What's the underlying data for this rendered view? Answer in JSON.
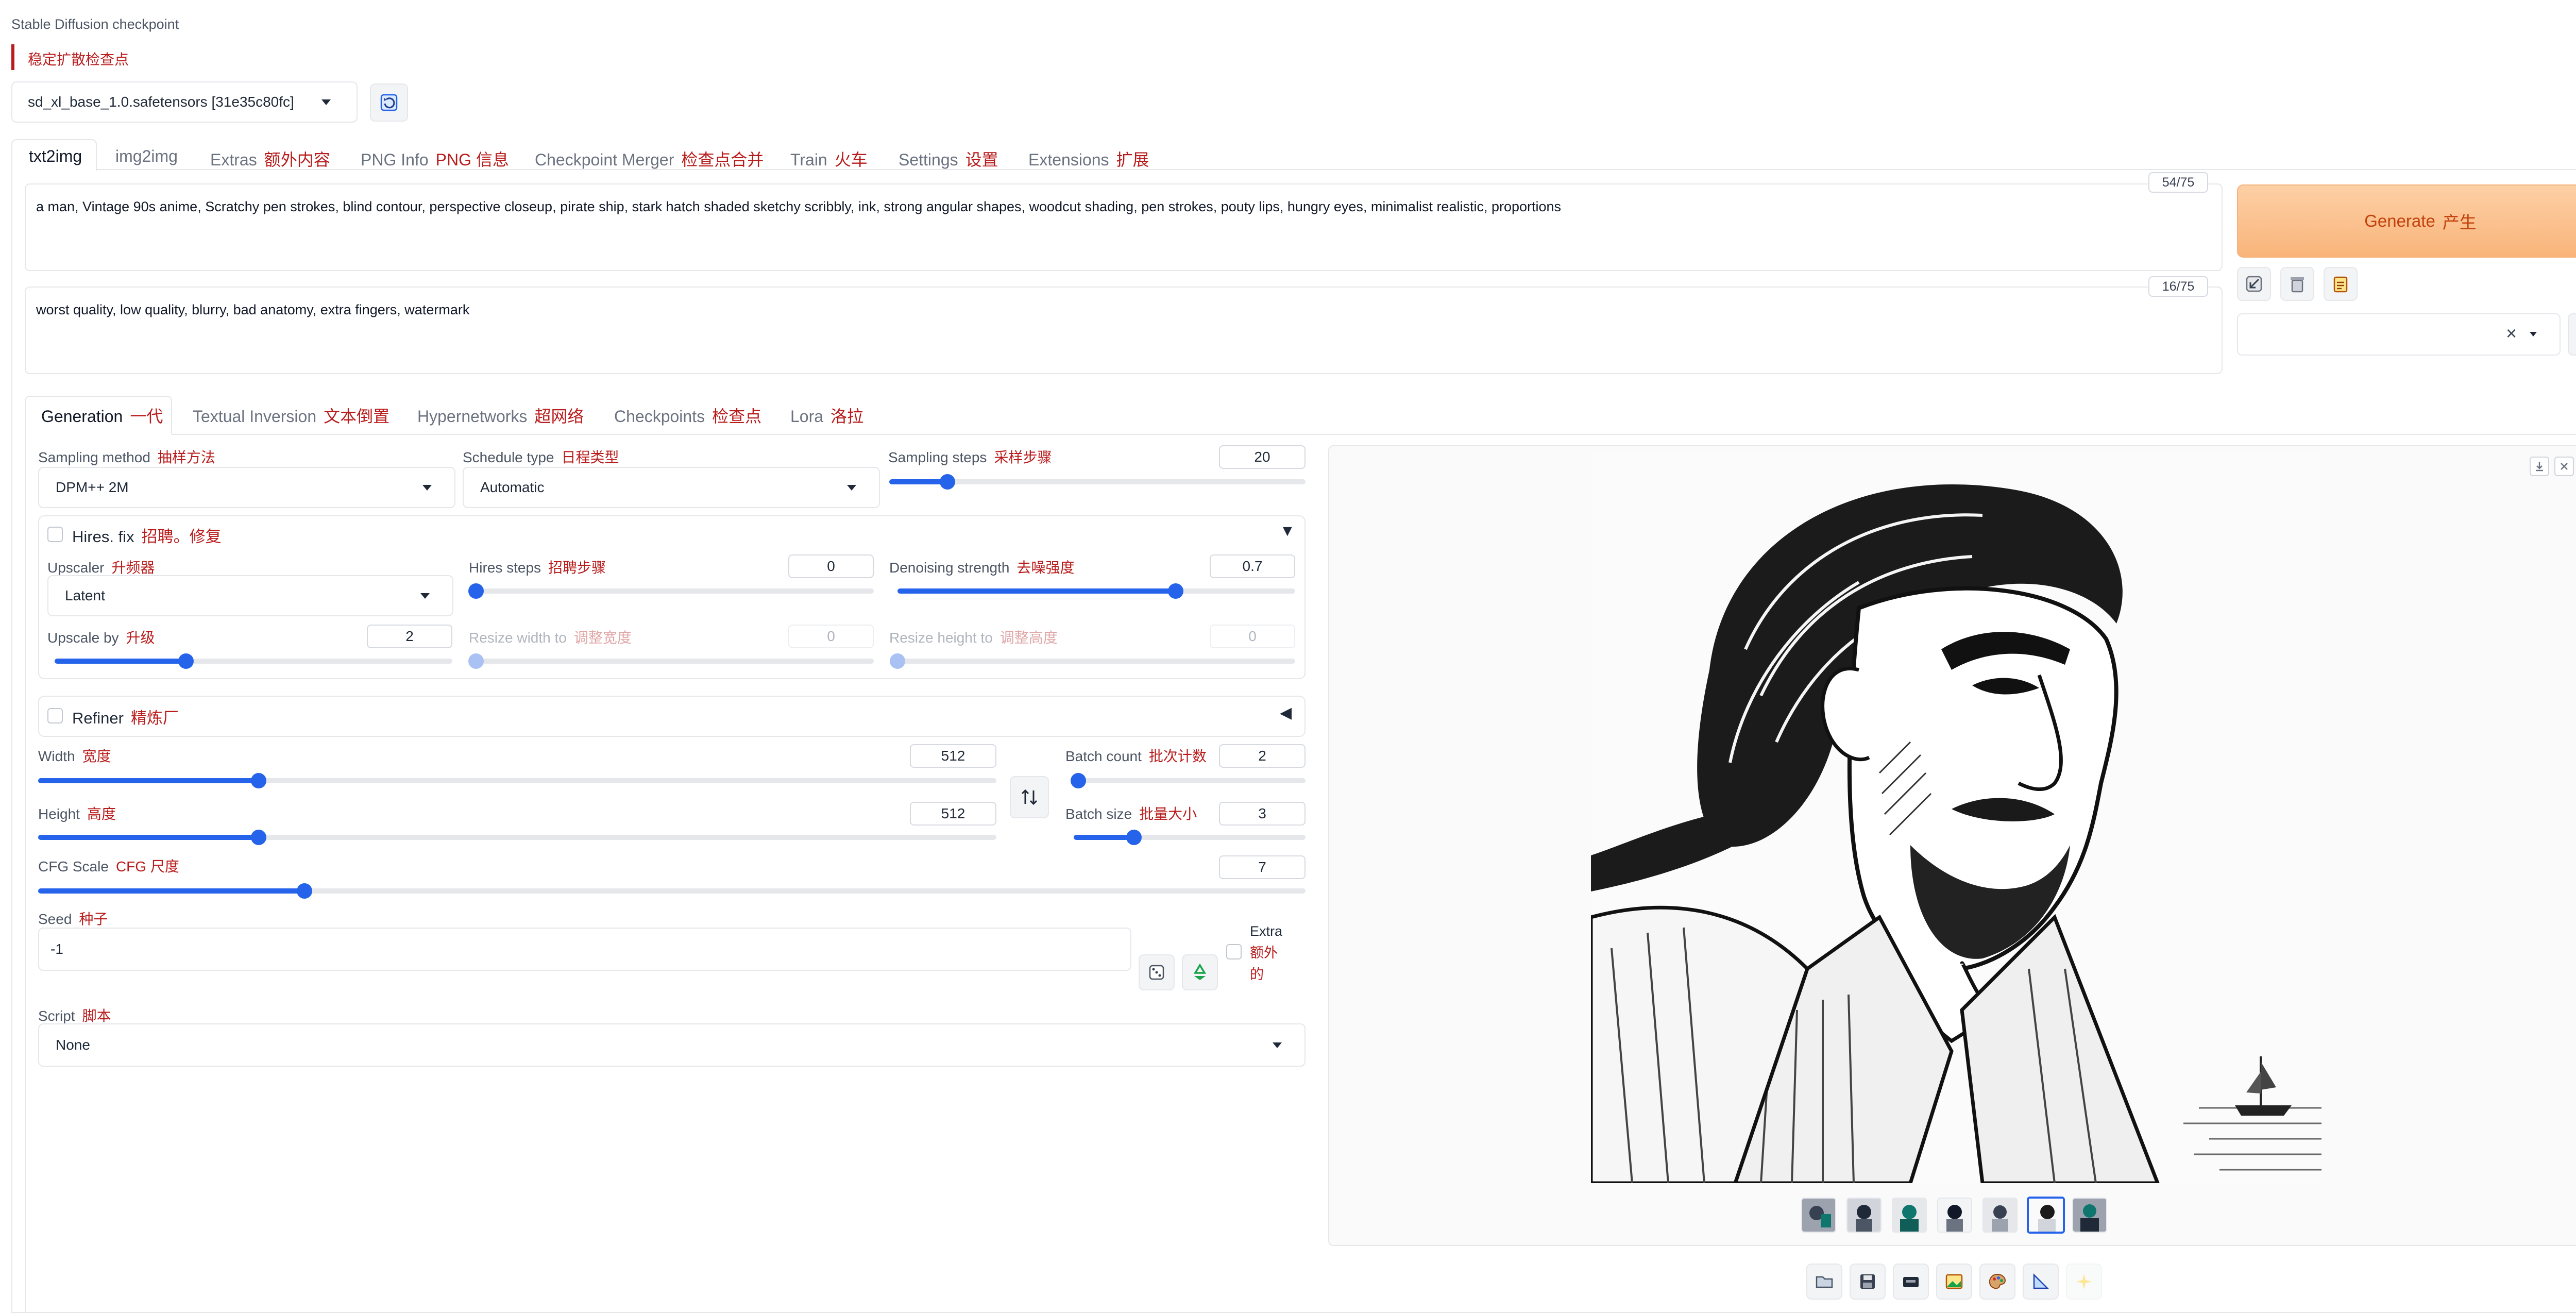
{
  "checkpoint": {
    "label": "Stable Diffusion checkpoint",
    "label_cn": "稳定扩散检查点",
    "value": "sd_xl_base_1.0.safetensors [31e35c80fc]"
  },
  "tabs": [
    {
      "en": "txt2img",
      "cn": ""
    },
    {
      "en": "img2img",
      "cn": ""
    },
    {
      "en": "Extras",
      "cn": "额外内容"
    },
    {
      "en": "PNG Info",
      "cn": "PNG 信息"
    },
    {
      "en": "Checkpoint Merger",
      "cn": "检查点合并"
    },
    {
      "en": "Train",
      "cn": "火车"
    },
    {
      "en": "Settings",
      "cn": "设置"
    },
    {
      "en": "Extensions",
      "cn": "扩展"
    }
  ],
  "prompt": {
    "text": "a man, Vintage 90s anime, Scratchy pen strokes, blind contour, perspective closeup, pirate ship, stark hatch shaded sketchy scribbly, ink, strong angular shapes, woodcut shading, pen strokes, pouty lips, hungry eyes, minimalist realistic, proportions",
    "counter": "54/75"
  },
  "negative_prompt": {
    "text": "worst quality, low quality, blurry, bad anatomy, extra fingers, watermark",
    "counter": "16/75"
  },
  "generate": {
    "en": "Generate",
    "cn": "产生"
  },
  "style_select": {
    "clear": "×"
  },
  "subtabs": [
    {
      "en": "Generation",
      "cn": "一代"
    },
    {
      "en": "Textual Inversion",
      "cn": "文本倒置"
    },
    {
      "en": "Hypernetworks",
      "cn": "超网络"
    },
    {
      "en": "Checkpoints",
      "cn": "检查点"
    },
    {
      "en": "Lora",
      "cn": "洛拉"
    }
  ],
  "sampling_method": {
    "en": "Sampling method",
    "cn": "抽样方法",
    "value": "DPM++ 2M"
  },
  "schedule_type": {
    "en": "Schedule type",
    "cn": "日程类型",
    "value": "Automatic"
  },
  "sampling_steps": {
    "en": "Sampling steps",
    "cn": "采样步骤",
    "value": "20",
    "fraction": 0.14
  },
  "hires": {
    "en": "Hires. fix",
    "cn": "招聘。修复",
    "collapse_icon": "▼",
    "upscaler": {
      "en": "Upscaler",
      "cn": "升频器",
      "value": "Latent"
    },
    "hires_steps": {
      "en": "Hires steps",
      "cn": "招聘步骤",
      "value": "0",
      "fraction": 0.0
    },
    "denoising": {
      "en": "Denoising strength",
      "cn": "去噪强度",
      "value": "0.7",
      "fraction": 0.7
    },
    "upscale_by": {
      "en": "Upscale by",
      "cn": "升级",
      "value": "2",
      "fraction": 0.33
    },
    "resize_width": {
      "en": "Resize width to",
      "cn": "调整宽度",
      "value": "0",
      "fraction": 0.0
    },
    "resize_height": {
      "en": "Resize height to",
      "cn": "调整高度",
      "value": "0",
      "fraction": 0.0
    }
  },
  "refiner": {
    "en": "Refiner",
    "cn": "精炼厂",
    "expand_icon": "◀"
  },
  "width": {
    "en": "Width",
    "cn": "宽度",
    "value": "512",
    "fraction": 0.23
  },
  "height": {
    "en": "Height",
    "cn": "高度",
    "value": "512",
    "fraction": 0.23
  },
  "batch_count": {
    "en": "Batch count",
    "cn": "批次计数",
    "value": "2",
    "fraction": 0.02
  },
  "batch_size": {
    "en": "Batch size",
    "cn": "批量大小",
    "value": "3",
    "fraction": 0.26
  },
  "cfg_scale": {
    "en": "CFG Scale",
    "cn": "CFG 尺度",
    "value": "7",
    "fraction": 0.21
  },
  "seed": {
    "en": "Seed",
    "cn": "种子",
    "value": "-1"
  },
  "extra": {
    "en": "Extra",
    "cn": "额外的"
  },
  "script": {
    "en": "Script",
    "cn": "脚本",
    "value": "None"
  },
  "colors": {
    "accent": "#2563eb",
    "cn_text": "#b91c1c",
    "generate_bg": "#fbc48f",
    "generate_text": "#c2410c"
  }
}
